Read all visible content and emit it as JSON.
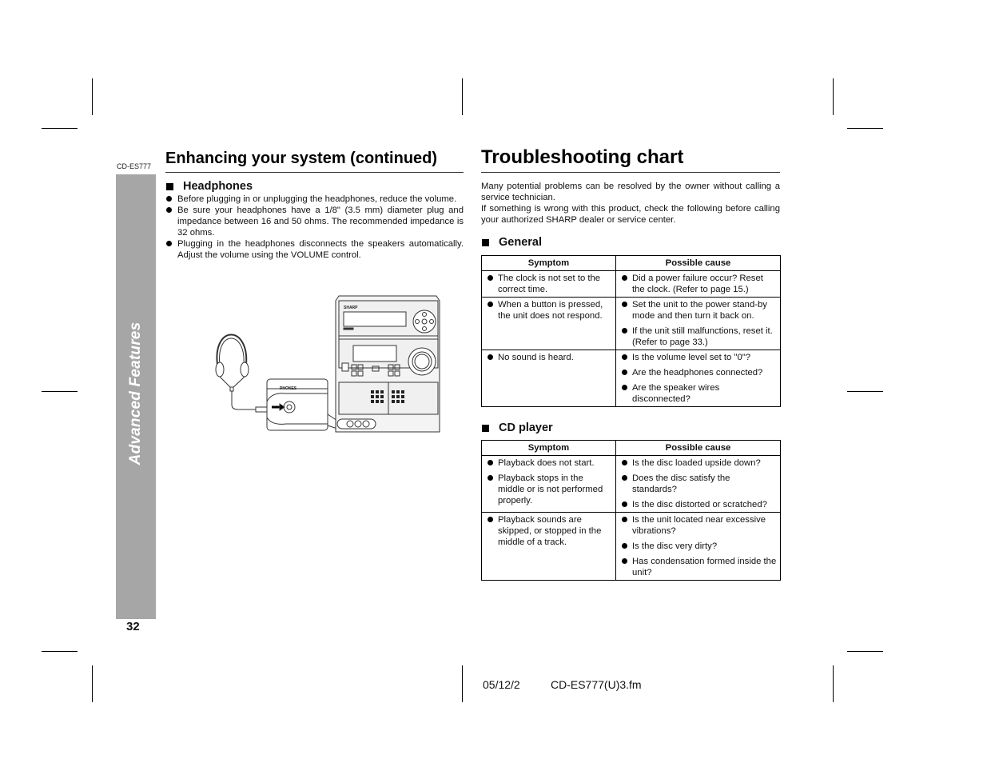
{
  "header": {
    "model_tag": "CD-ES777",
    "left_title": "Enhancing your system (continued)",
    "right_title": "Troubleshooting chart"
  },
  "sidebar": {
    "section_label": "Advanced Features",
    "page_number": "32"
  },
  "headphones": {
    "heading": "Headphones",
    "bullets": [
      "Before plugging in or unplugging the headphones, reduce the volume.",
      "Be sure your headphones have a 1/8\" (3.5 mm) diameter plug and impedance between 16 and 50 ohms. The recommended impedance is 32 ohms.",
      "Plugging in the headphones disconnects the speakers automatically. Adjust the volume using the VOLUME control."
    ],
    "illustration": {
      "jack_label": "PHONES",
      "brand_label": "SHARP"
    }
  },
  "troubleshooting": {
    "intro": [
      "Many potential problems can be resolved by the owner without calling a service technician.",
      "If something is wrong with this product, check the following before calling your authorized SHARP dealer or service center."
    ],
    "sections": [
      {
        "heading": "General",
        "columns": [
          "Symptom",
          "Possible cause"
        ],
        "rows": [
          {
            "symptoms": [
              "The clock is not set to the correct time."
            ],
            "causes": [
              "Did a power failure occur? Reset the clock. (Refer to page 15.)"
            ]
          },
          {
            "symptoms": [
              "When a button is pressed, the unit does not respond."
            ],
            "causes": [
              "Set the unit to the power stand-by mode and then turn it back on.",
              "If the unit still malfunctions, reset it. (Refer to page 33.)"
            ]
          },
          {
            "symptoms": [
              "No sound is heard."
            ],
            "causes": [
              "Is the volume level set to \"0\"?",
              "Are the headphones connected?",
              "Are the speaker wires disconnected?"
            ]
          }
        ]
      },
      {
        "heading": "CD player",
        "columns": [
          "Symptom",
          "Possible cause"
        ],
        "rows": [
          {
            "symptoms": [
              "Playback does not start.",
              "Playback stops in the middle or is not performed properly."
            ],
            "causes": [
              "Is the disc loaded upside down?",
              "Does the disc satisfy the standards?",
              "Is the disc distorted or scratched?"
            ]
          },
          {
            "symptoms": [
              "Playback sounds are skipped, or stopped in the middle of a track."
            ],
            "causes": [
              "Is the unit located near excessive vibrations?",
              "Is the disc very dirty?",
              "Has condensation formed inside the unit?"
            ]
          }
        ]
      }
    ]
  },
  "footer": {
    "date": "05/12/2",
    "file": "CD-ES777(U)3.fm"
  }
}
